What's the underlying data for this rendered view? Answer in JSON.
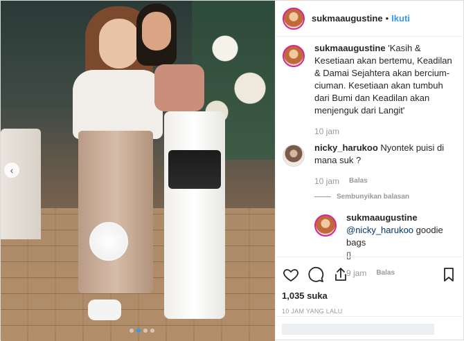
{
  "post": {
    "username": "sukmaaugustine",
    "separator": "•",
    "follow_label": "Ikuti",
    "caption": "'Kasih & Kesetiaan akan bertemu, Keadilan & Damai Sejahtera akan bercium-ciuman. Kesetiaan akan tumbuh dari Bumi dan Keadilan akan menjenguk dari Langit'",
    "caption_time": "10 jam"
  },
  "comments": [
    {
      "username": "nicky_harukoo",
      "text": "Nyontek puisi di mana suk ?",
      "time": "10 jam",
      "reply_label": "Balas",
      "hide_replies_label": "Sembunyikan balasan",
      "replies": [
        {
          "username": "sukmaaugustine",
          "mention": "@nicky_harukoo",
          "text": "goodie bags",
          "emoji": "▯",
          "time": "9 jam",
          "reply_label": "Balas"
        }
      ]
    }
  ],
  "stats": {
    "likes": "1,035 suka",
    "posted": "10 JAM YANG LALU"
  },
  "carousel": {
    "prev_arrow": "‹",
    "total_slides": 4,
    "active_slide": 1
  },
  "colors": {
    "accent": "#3897f0",
    "ring": "#d6249f",
    "text": "#262626",
    "muted": "#999999"
  },
  "icons": {
    "like": "heart-icon",
    "comment": "comment-icon",
    "share": "share-icon",
    "save": "bookmark-icon"
  }
}
